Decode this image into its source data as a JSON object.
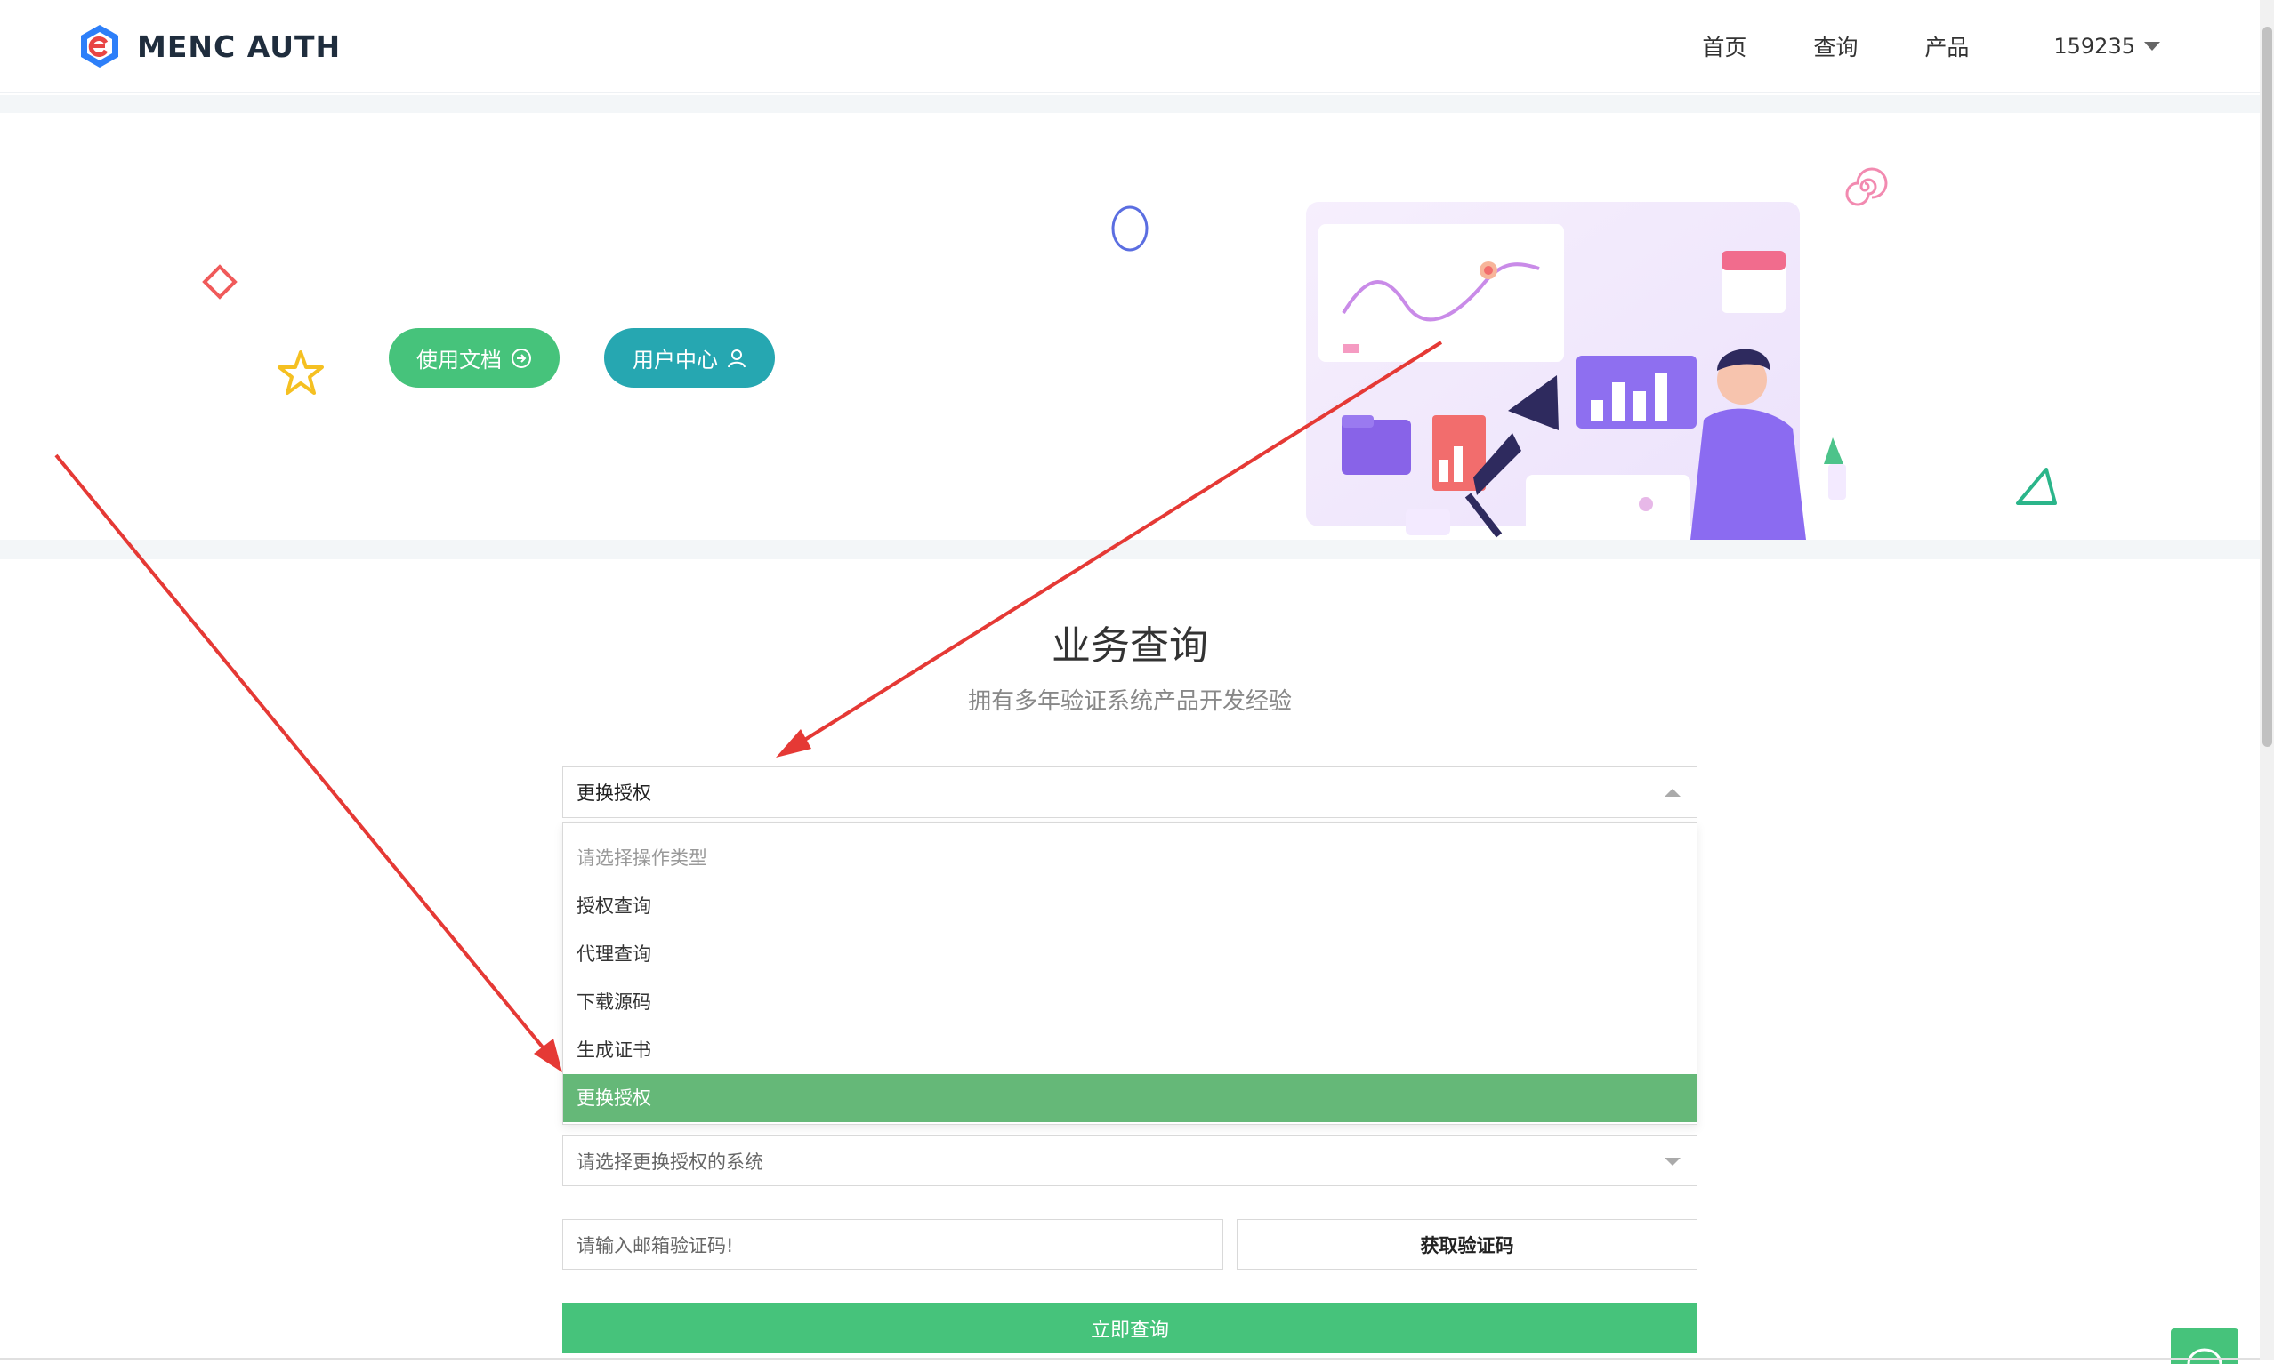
{
  "header": {
    "logo_text": "MENC AUTH",
    "nav": [
      "首页",
      "查询",
      "产品"
    ],
    "user": "159235"
  },
  "hero": {
    "docs_button": "使用文档",
    "user_button": "用户中心"
  },
  "query": {
    "title": "业务查询",
    "subtitle": "拥有多年验证系统产品开发经验",
    "operation_select": {
      "selected": "更换授权",
      "options": [
        "请选择操作类型",
        "授权查询",
        "代理查询",
        "下载源码",
        "生成证书",
        "更换授权"
      ]
    },
    "system_select_placeholder": "请选择更换授权的系统",
    "email_code_placeholder": "请输入邮箱验证码!",
    "get_code_button": "获取验证码",
    "submit_button": "立即查询"
  },
  "colors": {
    "primary_green": "#46c37b",
    "teal": "#26a7b1",
    "selected_option": "#65b878",
    "annotation_red": "#e53935"
  }
}
